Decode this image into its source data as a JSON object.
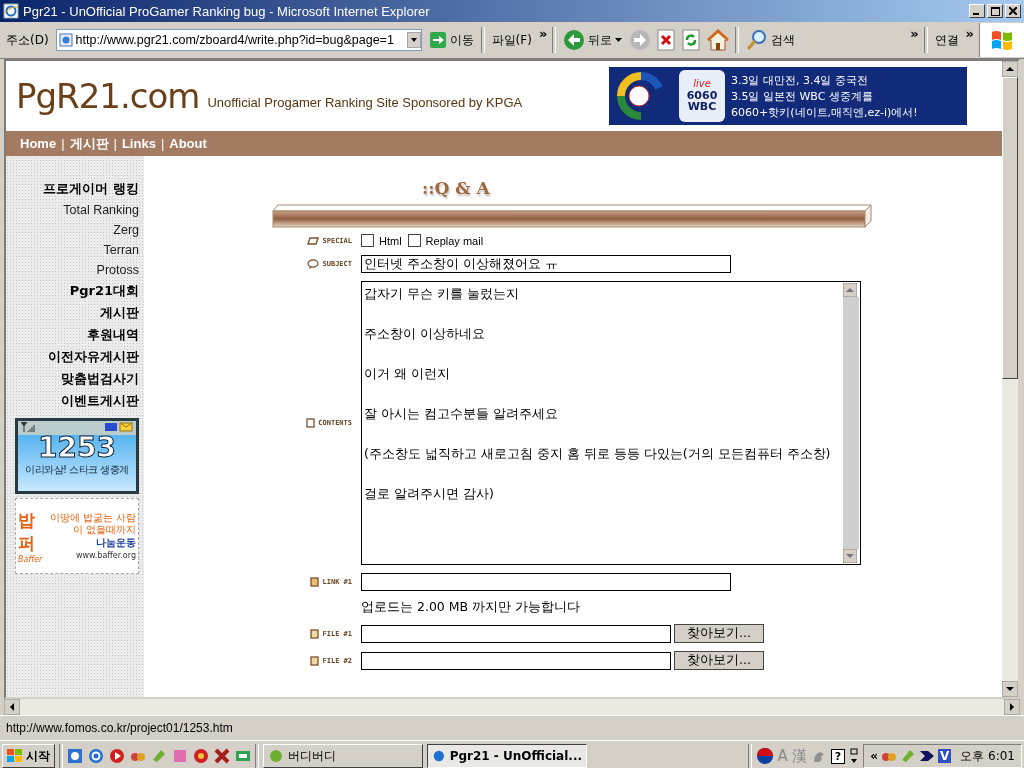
{
  "window": {
    "title": "Pgr21 - UnOfficial ProGamer Ranking bug - Microsoft Internet Explorer"
  },
  "toolbar": {
    "address_label": "주소(D)",
    "url": "http://www.pgr21.com/zboard4/write.php?id=bug&page=1",
    "go": "이동",
    "file_menu": "파일(F)",
    "more": "»",
    "back": "뒤로",
    "search": "검색",
    "links": "연결",
    "links_more": "»"
  },
  "site": {
    "logo": "PgR21.com",
    "tagline": "Unofficial Progamer Ranking Site Sponsored by KPGA",
    "banner": {
      "badge_live": "live",
      "badge_num": "6060",
      "badge_wbc": "WBC",
      "lines": [
        "3.3일 대만전, 3.4일 중국전",
        "3.5일 일본전 WBC 생중계를",
        "6060+핫키(네이트,매직엔,ez-i)에서!"
      ]
    },
    "nav": [
      {
        "label": "Home"
      },
      {
        "label": "게시판"
      },
      {
        "label": "Links"
      },
      {
        "label": "About"
      }
    ],
    "nav_sep": "|"
  },
  "sidebar": {
    "items": [
      {
        "label": "프로게이머 랭킹",
        "kind": "heading"
      },
      {
        "label": "Total Ranking",
        "kind": "sub"
      },
      {
        "label": "Zerg",
        "kind": "sub"
      },
      {
        "label": "Terran",
        "kind": "sub"
      },
      {
        "label": "Protoss",
        "kind": "sub"
      },
      {
        "label": "Pgr21대회",
        "kind": "heading"
      },
      {
        "label": "게시판",
        "kind": "heading"
      },
      {
        "label": "후원내역",
        "kind": "heading"
      },
      {
        "label": "이전자유게시판",
        "kind": "heading"
      },
      {
        "label": "맞춤법검사기",
        "kind": "heading"
      },
      {
        "label": "이벤트게시판",
        "kind": "heading"
      }
    ],
    "phone_ad": {
      "number": "1253",
      "caption": "이리와삼! 스타크 생중계"
    },
    "bapper_ad": {
      "logo": "밥퍼",
      "sub": "Baffer",
      "slogan": "이땅에 밥굶는 사람이 없을때까지",
      "campaign": "나눔운동",
      "url": "www.baffer.org"
    }
  },
  "form": {
    "title": "::Q & A",
    "special_label": "SPECIAL",
    "options": [
      {
        "label": "Html",
        "checked": false
      },
      {
        "label": "Replay mail",
        "checked": false
      }
    ],
    "subject_label": "SUBJECT",
    "subject": "인터넷 주소창이 이상해졌어요 ㅠ",
    "contents_label": "CONTENTS",
    "contents": [
      "갑자기 무슨 키를 눌렀는지",
      "주소창이 이상하네요",
      "이거 왜 이런지",
      "잘 아시는 컴고수분들 알려주세요",
      "(주소창도 넓직하고 새로고침 중지 홈 뒤로 등등 다있는(거의 모든컴퓨터 주소창)",
      "걸로 알려주시면 감사)"
    ],
    "link_label": "LINK #1",
    "upload_note": "업로드는 2.00 MB 까지만 가능합니다",
    "files": [
      {
        "label": "FILE #1",
        "button": "찾아보기..."
      },
      {
        "label": "FILE #2",
        "button": "찾아보기..."
      }
    ]
  },
  "status_bar": {
    "text": "http://www.fomos.co.kr/project01/1253.htm"
  },
  "taskbar": {
    "start": "시작",
    "tasks": [
      {
        "label": "버디버디",
        "selected": false
      },
      {
        "label": "Pgr21 - UnOfficial...",
        "selected": true
      }
    ],
    "tray_a": "A",
    "tray_han": "漢",
    "tray_help": "?",
    "tray_more": "«",
    "tray_v": "V",
    "clock": "오후 6:01"
  }
}
